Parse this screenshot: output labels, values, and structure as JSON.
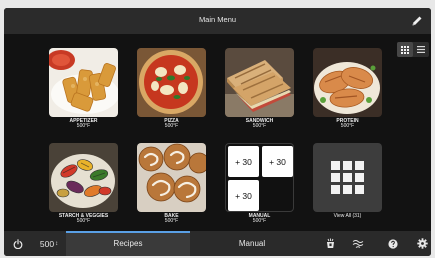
{
  "header": {
    "title": "Main Menu",
    "edit_icon": "pencil-icon"
  },
  "view_toggle": {
    "grid_icon": "grid-view-icon",
    "list_icon": "list-view-icon",
    "selected": "grid"
  },
  "recipes": [
    {
      "name": "APPETIZER",
      "temp": "500°F"
    },
    {
      "name": "PIZZA",
      "temp": "500°F"
    },
    {
      "name": "SANDWICH",
      "temp": "500°F"
    },
    {
      "name": "PROTEIN",
      "temp": "500°F"
    },
    {
      "name": "STARCH & VEGGIES",
      "temp": "500°F"
    },
    {
      "name": "BAKE",
      "temp": "500°F"
    },
    {
      "name": "MANUAL",
      "temp": "500°F",
      "chips": [
        "+ 30",
        "+ 30",
        "+ 30"
      ]
    },
    {
      "name": "View All (31)"
    }
  ],
  "bottom_bar": {
    "power_icon": "power-icon",
    "temperature": "500",
    "temperature_unit_mark": "↕",
    "tabs": [
      {
        "label": "Recipes",
        "active": true
      },
      {
        "label": "Manual",
        "active": false
      }
    ],
    "icons": [
      "oven-cleaning-icon",
      "fan-icon",
      "help-icon",
      "settings-icon"
    ],
    "accent_color": "#5aa0e6"
  }
}
